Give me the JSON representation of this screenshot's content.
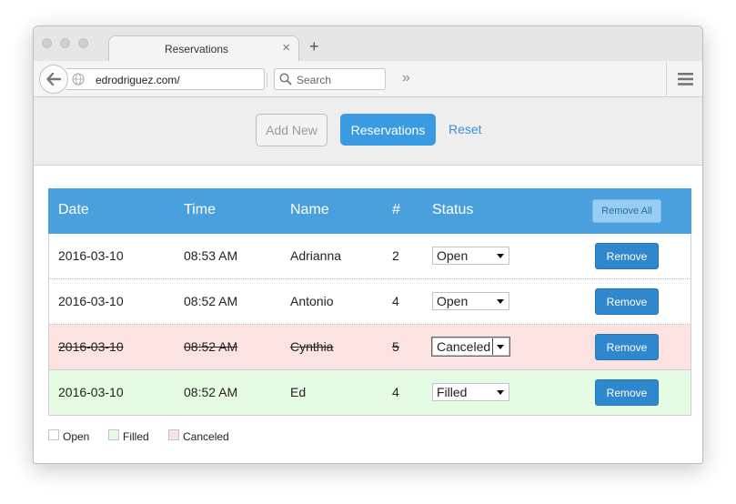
{
  "browser": {
    "tab_title": "Reservations",
    "tab_close": "×",
    "new_tab": "+",
    "url": "edrodriguez.com/",
    "search_placeholder": "Search",
    "overflow": "»"
  },
  "toolbar": {
    "add_new_label": "Add New",
    "reservations_label": "Reservations",
    "reset_label": "Reset"
  },
  "table": {
    "headers": {
      "date": "Date",
      "time": "Time",
      "name": "Name",
      "count": "#",
      "status": "Status",
      "remove_all": "Remove All"
    },
    "rows": [
      {
        "date": "2016-03-10",
        "time": "08:53 AM",
        "name": "Adrianna",
        "count": "2",
        "status": "Open",
        "remove": "Remove"
      },
      {
        "date": "2016-03-10",
        "time": "08:52 AM",
        "name": "Antonio",
        "count": "4",
        "status": "Open",
        "remove": "Remove"
      },
      {
        "date": "2016-03-10",
        "time": "08:52 AM",
        "name": "Cynthia",
        "count": "5",
        "status": "Canceled",
        "remove": "Remove"
      },
      {
        "date": "2016-03-10",
        "time": "08:52 AM",
        "name": "Ed",
        "count": "4",
        "status": "Filled",
        "remove": "Remove"
      }
    ]
  },
  "legend": {
    "items": [
      {
        "label": "Open",
        "color": "#ffffff"
      },
      {
        "label": "Filled",
        "color": "#e6fbe4"
      },
      {
        "label": "Canceled",
        "color": "#fde2e2"
      }
    ]
  },
  "colors": {
    "accent": "#3a9be3",
    "header_blue": "#4aa0dc",
    "remove_button": "#2f87cd",
    "canceled_row": "#fde2e2",
    "filled_row": "#e6fbe4"
  }
}
